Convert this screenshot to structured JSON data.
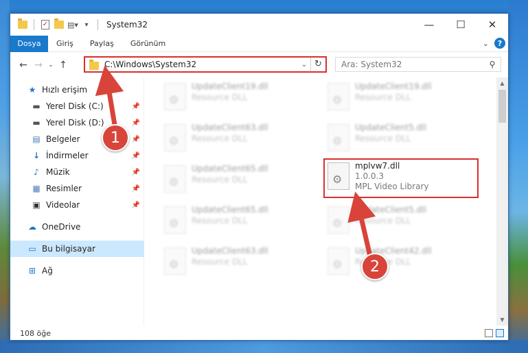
{
  "window": {
    "title": "System32"
  },
  "ribbon": {
    "tabs": [
      "Dosya",
      "Giriş",
      "Paylaş",
      "Görünüm"
    ],
    "help": "?"
  },
  "nav": {
    "address": "C:\\Windows\\System32",
    "search_placeholder": "Ara: System32"
  },
  "sidebar": {
    "items": [
      {
        "label": "Hızlı erişim",
        "icon": "star-icon"
      },
      {
        "label": "Yerel Disk (C:)",
        "icon": "drive-icon",
        "pinned": true
      },
      {
        "label": "Yerel Disk (D:)",
        "icon": "drive-icon",
        "pinned": true
      },
      {
        "label": "Belgeler",
        "icon": "documents-icon",
        "pinned": true
      },
      {
        "label": "İndirmeler",
        "icon": "download-icon",
        "pinned": true
      },
      {
        "label": "Müzik",
        "icon": "music-icon",
        "pinned": true
      },
      {
        "label": "Resimler",
        "icon": "pictures-icon",
        "pinned": true
      },
      {
        "label": "Videolar",
        "icon": "videos-icon",
        "pinned": true
      },
      {
        "label": "OneDrive",
        "icon": "cloud-icon"
      },
      {
        "label": "Bu bilgisayar",
        "icon": "computer-icon",
        "selected": true
      },
      {
        "label": "Ağ",
        "icon": "network-icon"
      }
    ]
  },
  "files": [
    {
      "name": "UpdateClient19.dll",
      "sub": "Resource DLL",
      "blurred": true
    },
    {
      "name": "UpdateClient19.dll",
      "sub": "Resource DLL",
      "blurred": true
    },
    {
      "name": "UpdateClient63.dll",
      "sub": "Resource DLL",
      "blurred": true
    },
    {
      "name": "UpdateClient5.dll",
      "sub": "Resource DLL",
      "blurred": true
    },
    {
      "name": "UpdateClient65.dll",
      "sub": "Resource DLL",
      "blurred": true
    },
    {
      "name": "mplvw7.dll",
      "version": "1.0.0.3",
      "sub": "MPL Video Library",
      "highlighted": true
    },
    {
      "name": "UpdateClient65.dll",
      "sub": "Resource DLL",
      "blurred": true
    },
    {
      "name": "UpdateClient5.dll",
      "sub": "Resource DLL",
      "blurred": true
    },
    {
      "name": "UpdateClient63.dll",
      "sub": "Resource DLL",
      "blurred": true
    },
    {
      "name": "UpdateClient42.dll",
      "sub": "Resource DLL",
      "blurred": true
    }
  ],
  "status": {
    "count": "108 öğe"
  },
  "annotations": {
    "step1": "1",
    "step2": "2",
    "accent": "#d62f2f"
  }
}
